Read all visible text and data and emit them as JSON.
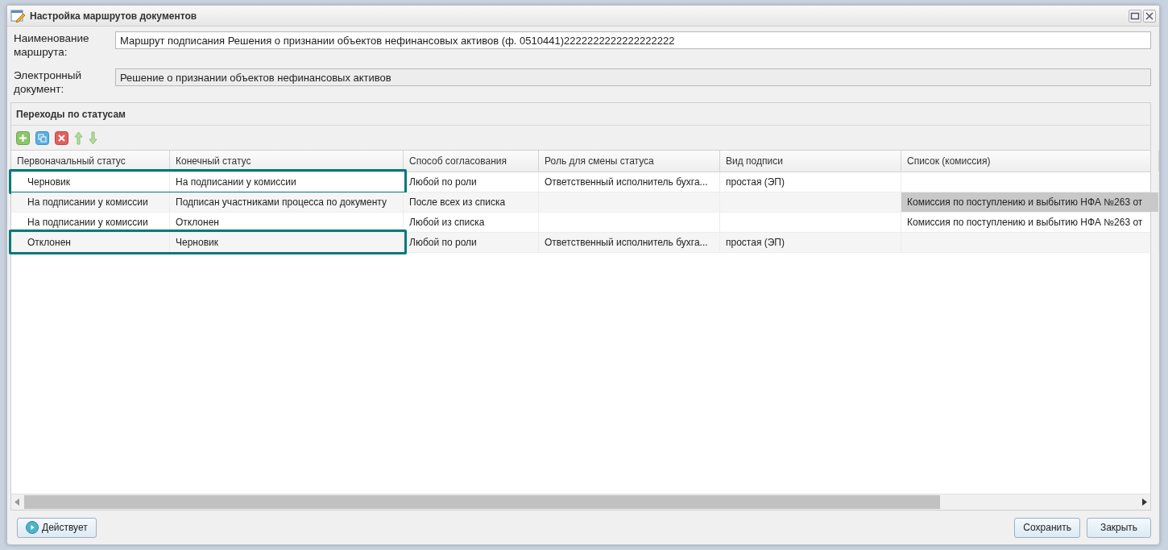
{
  "window": {
    "title": "Настройка маршрутов документов"
  },
  "form": [
    {
      "label": "Наименование маршрута:",
      "value": "Маршрут подписания Решения о признании объектов нефинансовых активов (ф. 0510441)2222222222222222222",
      "readonly": false
    },
    {
      "label": "Электронный документ:",
      "value": "Решение о признании объектов нефинансовых активов",
      "readonly": true
    }
  ],
  "panel": {
    "title": "Переходы по статусам",
    "toolbar": [
      {
        "kind": "add"
      },
      {
        "kind": "copy"
      },
      {
        "kind": "delete"
      },
      {
        "kind": "up"
      },
      {
        "kind": "down"
      }
    ]
  },
  "table": {
    "columns": [
      "Первоначальный статус",
      "Конечный статус",
      "Способ согласования",
      "Роль для смены статуса",
      "Вид подписи",
      "Список (комиссия)"
    ],
    "rows": [
      {
        "highlighted": true,
        "cells": [
          {
            "text": "Черновик",
            "selected": false
          },
          {
            "text": "На подписании у комиссии",
            "selected": false
          },
          {
            "text": "Любой по роли",
            "selected": false
          },
          {
            "text": "Ответственный исполнитель бухга...",
            "selected": false
          },
          {
            "text": "простая (ЭП)",
            "selected": false
          },
          {
            "selected": false
          }
        ]
      },
      {
        "highlighted": false,
        "cells": [
          {
            "text": "На подписании у комиссии",
            "selected": false
          },
          {
            "text": "Подписан участниками процесса по документу",
            "selected": false
          },
          {
            "text": "После всех из списка",
            "selected": false
          },
          {
            "selected": false
          },
          {
            "selected": false
          },
          {
            "text": "Комиссия по поступлению и выбытию НФА №263 от",
            "selected": true
          }
        ]
      },
      {
        "highlighted": false,
        "cells": [
          {
            "text": "На подписании у комиссии",
            "selected": false
          },
          {
            "text": "Отклонен",
            "selected": false
          },
          {
            "text": "Любой из списка",
            "selected": false
          },
          {
            "selected": false
          },
          {
            "selected": false
          },
          {
            "text": "Комиссия по поступлению и выбытию НФА №263 от",
            "selected": false
          }
        ]
      },
      {
        "highlighted": true,
        "cells": [
          {
            "text": "Отклонен",
            "selected": false
          },
          {
            "text": "Черновик",
            "selected": false
          },
          {
            "text": "Любой по роли",
            "selected": false
          },
          {
            "text": "Ответственный исполнитель бухга...",
            "selected": false
          },
          {
            "text": "простая (ЭП)",
            "selected": false
          },
          {
            "selected": false
          }
        ]
      }
    ]
  },
  "footer": {
    "status_button": "Действует",
    "buttons": [
      "Сохранить",
      "Закрыть"
    ]
  }
}
